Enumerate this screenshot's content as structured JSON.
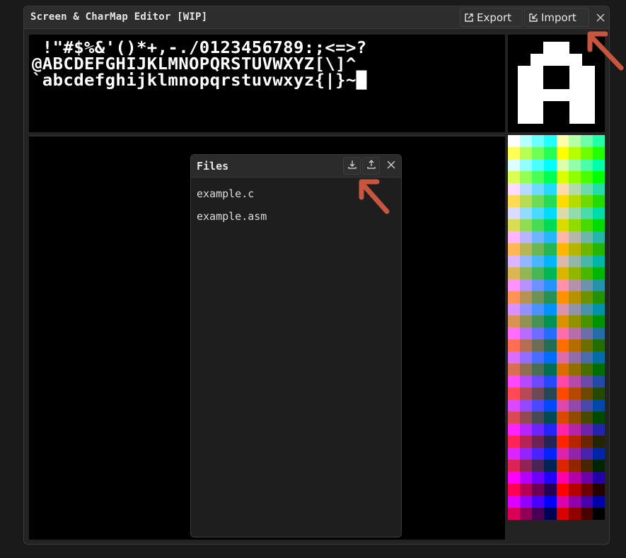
{
  "window": {
    "title": "Screen & CharMap Editor [WIP]",
    "export_label": "Export",
    "import_label": "Import"
  },
  "charset": {
    "rows": [
      " !\"#$%&'()*+,-./0123456789:;<=>?",
      "@ABCDEFGHIJKLMNOPQRSTUVWXYZ[\\]^_",
      "`abcdefghijklmnopqrstuvwxyz{|}~█"
    ],
    "selected_char": "A"
  },
  "files_panel": {
    "title": "Files",
    "items": [
      "example.c",
      "example.asm"
    ]
  },
  "colors": {
    "highlight_arrow": "#c8553d",
    "background": "#000000",
    "foreground": "#ffffff"
  },
  "icons": {
    "export": "external-link-icon",
    "import": "import-arrow-icon",
    "close": "close-icon",
    "download": "download-icon",
    "upload": "upload-icon"
  }
}
